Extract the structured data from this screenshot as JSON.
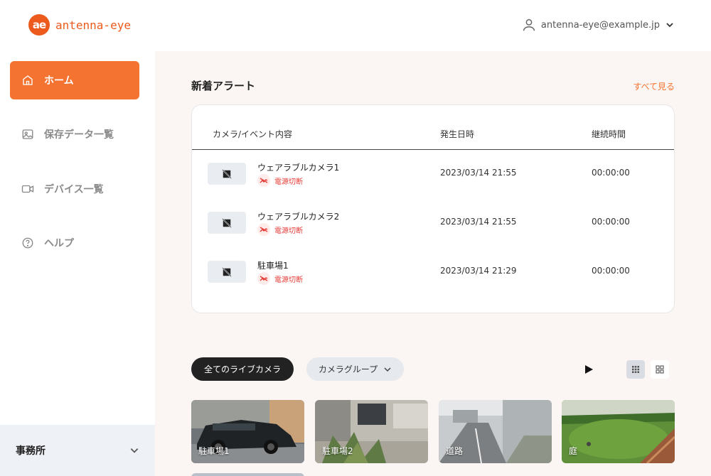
{
  "header": {
    "logo_mark": "ae",
    "logo_text": "antenna-eye",
    "account_email": "antenna-eye@example.jp"
  },
  "sidebar": {
    "items": [
      {
        "label": "ホーム",
        "icon": "home-icon",
        "active": true
      },
      {
        "label": "保存データ一覧",
        "icon": "image-icon",
        "active": false
      },
      {
        "label": "デバイス一覧",
        "icon": "video-camera-icon",
        "active": false
      },
      {
        "label": "ヘルプ",
        "icon": "help-circle-icon",
        "active": false
      }
    ],
    "office_label": "事務所"
  },
  "alerts": {
    "title": "新着アラート",
    "see_all": "すべて見る",
    "columns": {
      "camera": "カメラ/イベント内容",
      "date": "発生日時",
      "duration": "継続時間"
    },
    "rows": [
      {
        "camera": "ウェアラブルカメラ1",
        "event": "電源切断",
        "date": "2023/03/14 21:55",
        "duration": "00:00:00"
      },
      {
        "camera": "ウェアラブルカメラ2",
        "event": "電源切断",
        "date": "2023/03/14 21:55",
        "duration": "00:00:00"
      },
      {
        "camera": "駐車場1",
        "event": "電源切断",
        "date": "2023/03/14 21:29",
        "duration": "00:00:00"
      }
    ]
  },
  "filters": {
    "all_live": "全てのライブカメラ",
    "camera_group": "カメラグループ"
  },
  "cameras": [
    {
      "label": "駐車場1"
    },
    {
      "label": "駐車場2"
    },
    {
      "label": "道路"
    },
    {
      "label": "庭"
    }
  ],
  "colors": {
    "accent": "#f47330",
    "logo": "#ec5a1c",
    "alert_red": "#e53935",
    "chip_dark": "#222222"
  }
}
